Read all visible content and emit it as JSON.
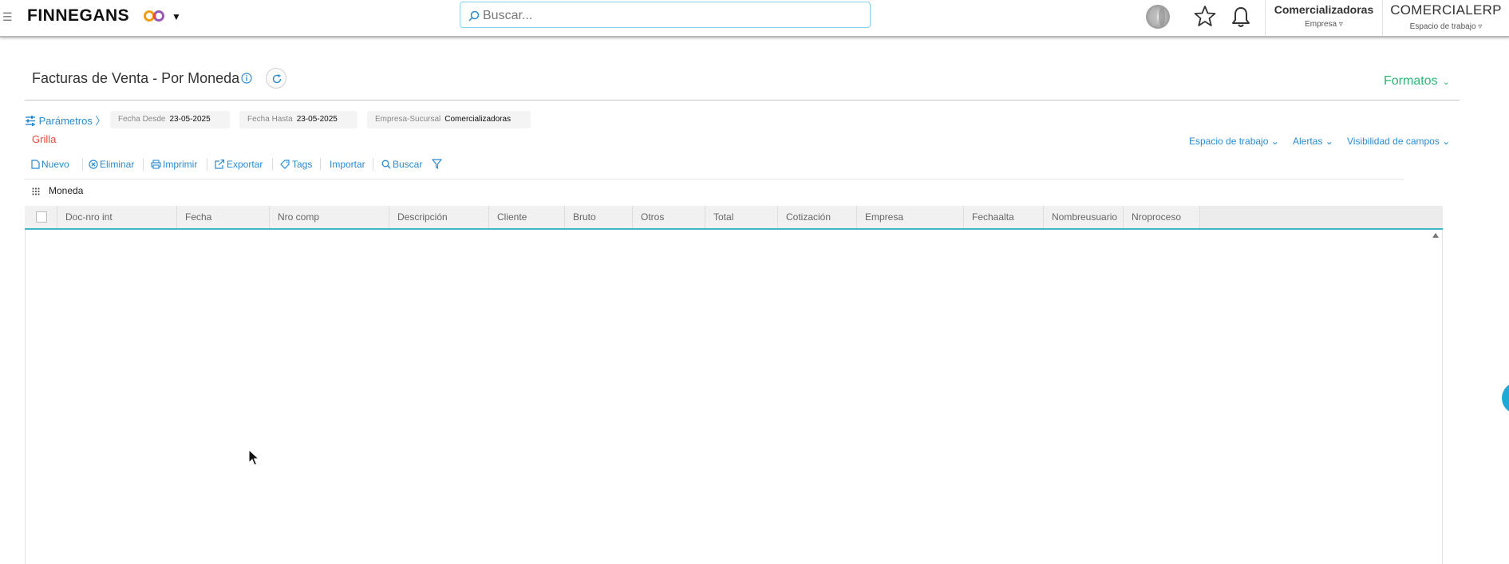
{
  "topbar": {
    "brand": "FINNEGANS",
    "search_placeholder": "Buscar...",
    "company": {
      "name": "Comercializadoras",
      "sub": "Empresa ▿"
    },
    "workspace": {
      "name": "COMERCIALERP",
      "sub": "Espacio de trabajo ▿"
    }
  },
  "page": {
    "title": "Facturas de Venta - Por Moneda",
    "formatos": "Formatos"
  },
  "params": {
    "link": "Parámetros 〉",
    "fecha_desde_label": "Fecha Desde",
    "fecha_desde_value": "23-05-2025",
    "fecha_hasta_label": "Fecha Hasta",
    "fecha_hasta_value": "23-05-2025",
    "empresa_label": "Empresa-Sucursal",
    "empresa_value": "Comercializadoras"
  },
  "view": {
    "grilla": "Grilla",
    "espacio": "Espacio de trabajo",
    "alertas": "Alertas",
    "visibilidad": "Visibilidad de campos"
  },
  "toolbar": {
    "nuevo": "Nuevo",
    "eliminar": "Eliminar",
    "imprimir": "Imprimir",
    "exportar": "Exportar",
    "tags": "Tags",
    "importar": "Importar",
    "buscar": "Buscar"
  },
  "group": {
    "label": "Moneda"
  },
  "grid": {
    "columns": [
      "Doc-nro int",
      "Fecha",
      "Nro comp",
      "Descripción",
      "Cliente",
      "Bruto",
      "Otros",
      "Total",
      "Cotización",
      "Empresa",
      "Fechaalta",
      "Nombreusuario",
      "Nroproceso"
    ],
    "rows": []
  },
  "colors": {
    "link": "#2a8bd0",
    "green": "#2bb673",
    "red": "#e74c3c",
    "teal": "#3fb6c8"
  }
}
